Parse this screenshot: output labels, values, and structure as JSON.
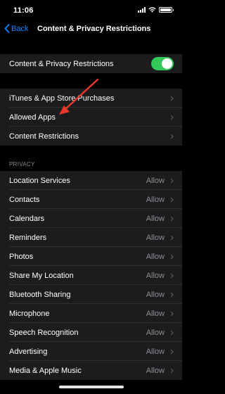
{
  "status": {
    "time": "11:06"
  },
  "nav": {
    "back_label": "Back",
    "title": "Content & Privacy Restrictions"
  },
  "toggle_row": {
    "label": "Content & Privacy Restrictions",
    "enabled": true
  },
  "store_rows": [
    {
      "label": "iTunes & App Store Purchases"
    },
    {
      "label": "Allowed Apps"
    },
    {
      "label": "Content Restrictions"
    }
  ],
  "privacy": {
    "header": "PRIVACY",
    "rows": [
      {
        "label": "Location Services",
        "value": "Allow"
      },
      {
        "label": "Contacts",
        "value": "Allow"
      },
      {
        "label": "Calendars",
        "value": "Allow"
      },
      {
        "label": "Reminders",
        "value": "Allow"
      },
      {
        "label": "Photos",
        "value": "Allow"
      },
      {
        "label": "Share My Location",
        "value": "Allow"
      },
      {
        "label": "Bluetooth Sharing",
        "value": "Allow"
      },
      {
        "label": "Microphone",
        "value": "Allow"
      },
      {
        "label": "Speech Recognition",
        "value": "Allow"
      },
      {
        "label": "Advertising",
        "value": "Allow"
      },
      {
        "label": "Media & Apple Music",
        "value": "Allow"
      }
    ]
  },
  "colors": {
    "accent": "#0a84ff",
    "toggle_on": "#34c759",
    "arrow": "#e8392b",
    "cell": "#1c1c1e",
    "secondary": "#8e8e93"
  }
}
